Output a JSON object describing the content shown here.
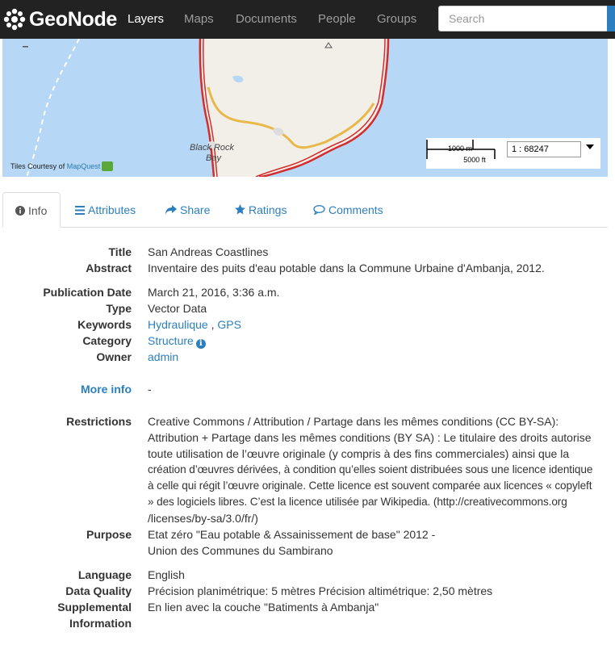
{
  "navbar": {
    "brand": "GeoNode",
    "items": [
      {
        "label": "Layers",
        "active": true
      },
      {
        "label": "Maps",
        "active": false
      },
      {
        "label": "Documents",
        "active": false
      },
      {
        "label": "People",
        "active": false
      },
      {
        "label": "Groups",
        "active": false
      }
    ],
    "search_placeholder": "Search"
  },
  "map": {
    "place_label_line1": "Black Rock",
    "place_label_line2": "Bay",
    "attribution_prefix": "Tiles Courtesy of",
    "attribution_link": "MapQuest",
    "scale_top": "1000 m",
    "scale_bottom": "5000 ft",
    "scale_ratio": "1 : 68247",
    "colors": {
      "water": "#b6d7f5",
      "land": "#f2efe9",
      "coast_road": "#d42d2d",
      "road": "#e8b84a"
    }
  },
  "tabs": [
    {
      "label": "Info",
      "icon": "info-circle-icon",
      "active": true
    },
    {
      "label": "Attributes",
      "icon": "list-icon",
      "active": false
    },
    {
      "label": "Share",
      "icon": "share-icon",
      "active": false
    },
    {
      "label": "Ratings",
      "icon": "star-icon",
      "active": false
    },
    {
      "label": "Comments",
      "icon": "comment-icon",
      "active": false
    }
  ],
  "details": {
    "title_label": "Title",
    "title_value": "San Andreas Coastlines",
    "abstract_label": "Abstract",
    "abstract_value": "Inventaire des puits d'eau potable dans la Commune Urbaine d'Ambanja, 2012.",
    "publication_date_label": "Publication Date",
    "publication_date_value": "March 21, 2016, 3:36 a.m.",
    "type_label": "Type",
    "type_value": "Vector Data",
    "keywords_label": "Keywords",
    "keywords": [
      "Hydraulique",
      "GPS"
    ],
    "keyword_separator": " , ",
    "category_label": "Category",
    "category_value": "Structure",
    "owner_label": "Owner",
    "owner_value": "admin",
    "more_info_label": "More info",
    "more_info_value": "-",
    "restrictions_label": "Restrictions",
    "restrictions_lines": [
      "Creative Commons / Attribution / Partage dans les mêmes conditions (CC BY-SA):",
      "Attribution + Partage dans les mêmes conditions (BY SA) : Le titulaire des droits autorise",
      "toute utilisation de l’œuvre originale (y compris à des fins commerciales) ainsi que la",
      "création d’œuvres dérivées, à condition qu’elles soient distribuées sous une licence identique",
      "à celle qui régit l’œuvre originale. Cette licence est souvent comparée aux licences « copyleft",
      "» des logiciels libres. C’est la licence utilisée par Wikipedia. (http://creativecommons.org",
      "/licenses/by-sa/3.0/fr/)"
    ],
    "purpose_label": "Purpose",
    "purpose_lines": [
      "Etat zéro \"Eau potable & Assainissement de base\" 2012 -",
      "Union des Communes du Sambirano"
    ],
    "language_label": "Language",
    "language_value": "English",
    "data_quality_label": "Data Quality",
    "data_quality_value": "Précision planimétrique: 5 mètres Précision altimétrique: 2,50 mètres",
    "supplemental_label_line1": "Supplemental",
    "supplemental_label_line2": "Information",
    "supplemental_value": "En lien avec la couche \"Batiments à Ambanja\""
  }
}
